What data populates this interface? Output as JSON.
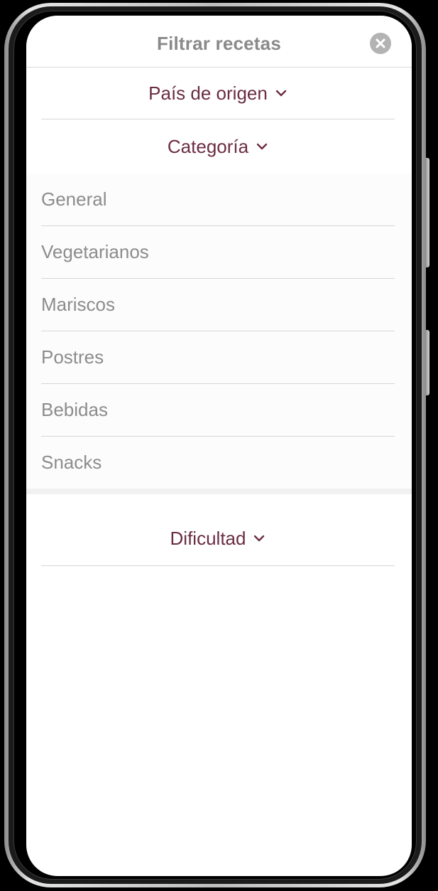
{
  "header": {
    "title": "Filtrar recetas",
    "close_icon": "close-circle-icon"
  },
  "sections": {
    "origin": {
      "label": "País de origen",
      "icon": "chevron-down-icon",
      "expanded": false
    },
    "category": {
      "label": "Categoría",
      "icon": "chevron-down-icon",
      "expanded": true,
      "items": [
        "General",
        "Vegetarianos",
        "Mariscos",
        "Postres",
        "Bebidas",
        "Snacks"
      ]
    },
    "difficulty": {
      "label": "Dificultad",
      "icon": "chevron-down-icon",
      "expanded": false
    }
  },
  "colors": {
    "accent": "#6b2c43",
    "muted_text": "#8c8c8c",
    "title_text": "#8a8a8a",
    "divider": "#d6d6d6"
  }
}
